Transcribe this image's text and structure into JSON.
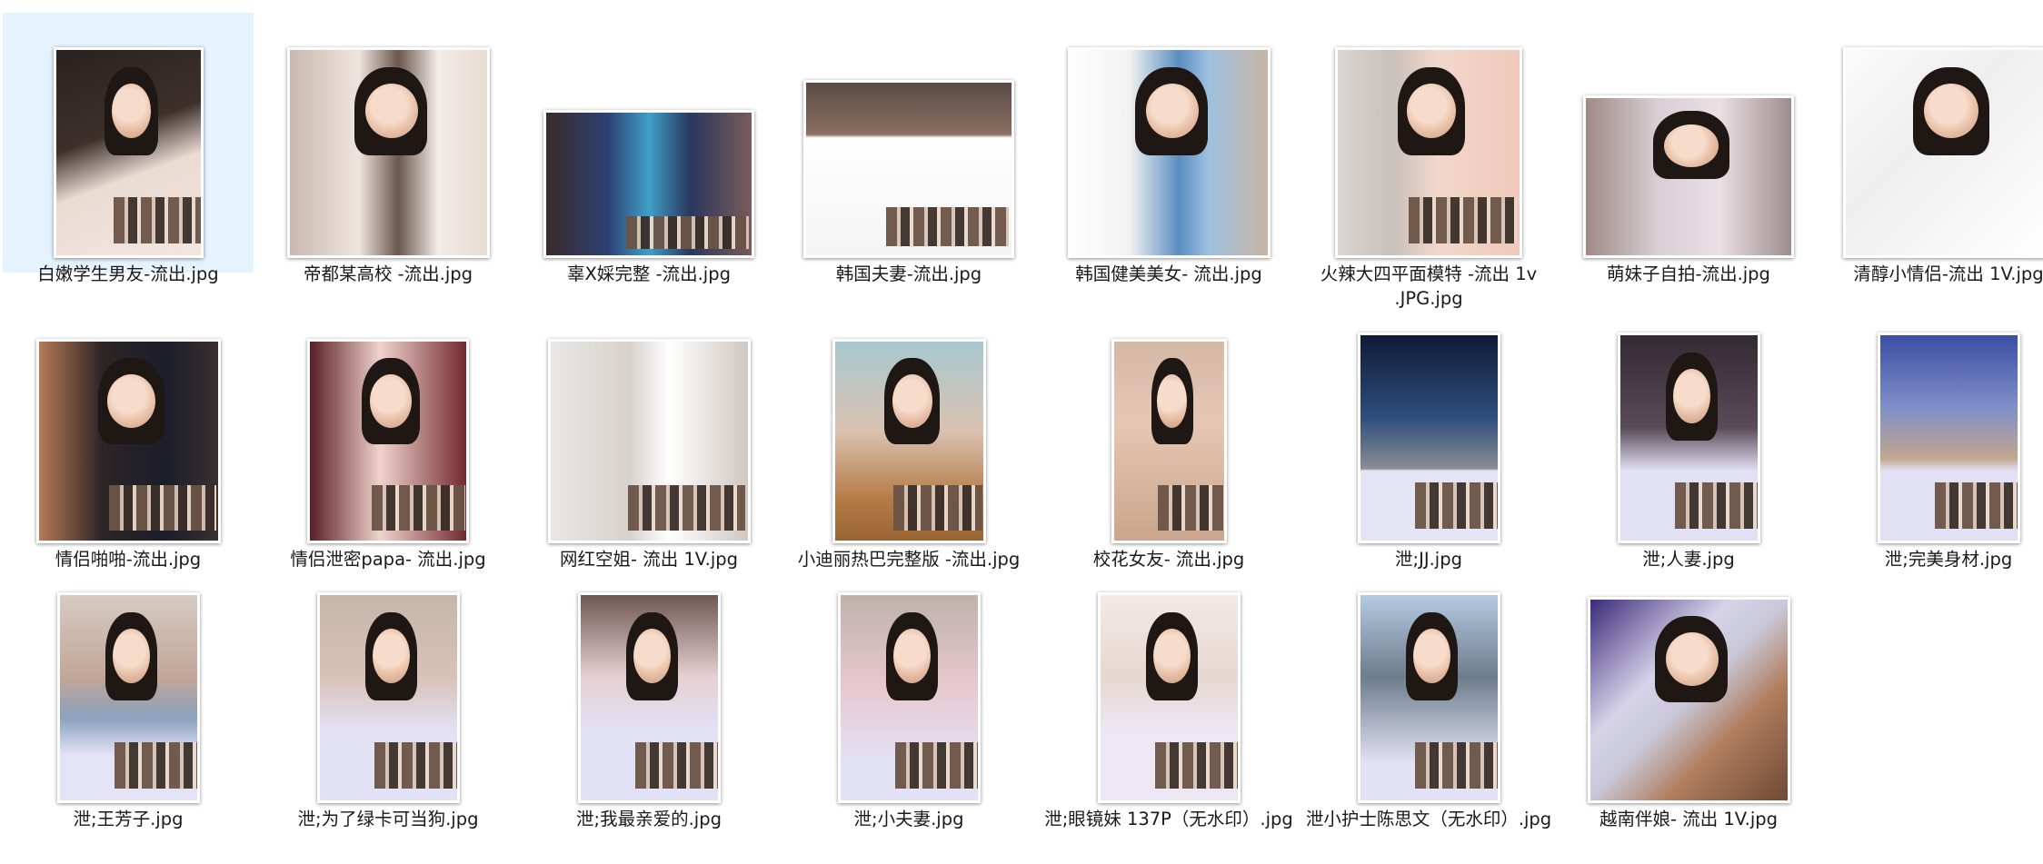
{
  "window": {
    "view": "large-icons"
  },
  "colors": {
    "selection_bg": "#e5f3ff",
    "text": "#1a1a1a"
  },
  "files": [
    {
      "name": "白嫩学生男友-流出.jpg",
      "selected": true,
      "thumb": {
        "w": 172,
        "h": 242,
        "bg": "linear-gradient(160deg,#2a2220 0%,#3d302b 40%,#eadbd3 60%,#f2e6df 100%)",
        "face": true,
        "strip": true
      }
    },
    {
      "name": "帝都某高校 -流出.jpg",
      "selected": false,
      "thumb": {
        "w": 232,
        "h": 242,
        "bg": "linear-gradient(90deg,#c9b8ae 0%,#efe4de 35%,#6a574d 55%,#f4ece8 75%,#e8dbd3 100%)",
        "face": true,
        "strip": false
      }
    },
    {
      "name": "辜X婇完整 -流出.jpg",
      "selected": false,
      "thumb": {
        "w": 242,
        "h": 170,
        "bg": "linear-gradient(90deg,#3b2a2a 0%,#2d3f73 30%,#3fa0c8 50%,#29375e 70%,#7a5b5a 100%)",
        "face": false,
        "strip": true
      }
    },
    {
      "name": "韩国夫妻-流出.jpg",
      "selected": false,
      "thumb": {
        "w": 242,
        "h": 204,
        "bg": "linear-gradient(180deg,#5a4a44 0%,#8b6f62 30%,#ffffff 32%,#f4f4f4 100%)",
        "face": false,
        "strip": true
      }
    },
    {
      "name": "韩国健美美女- 流出.jpg",
      "selected": false,
      "thumb": {
        "w": 232,
        "h": 242,
        "bg": "linear-gradient(90deg,#ffffff 0%,#f1f1f1 30%,#5a8dc0 55%,#9fc1e0 70%,#c8b4a4 100%)",
        "face": true,
        "strip": false
      }
    },
    {
      "name": "火辣大四平面模特 -流出 1v\n.JPG.jpg",
      "selected": false,
      "thumb": {
        "w": 215,
        "h": 242,
        "bg": "linear-gradient(90deg,#d9d5d2 0%,#c8c1bb 30%,#f2d7cb 55%,#f0c9bb 100%)",
        "face": true,
        "strip": true
      }
    },
    {
      "name": "萌妹子自拍-流出.jpg",
      "selected": false,
      "thumb": {
        "w": 242,
        "h": 186,
        "bg": "linear-gradient(90deg,#a08a86 0%,#d8cfd4 35%,#eadfe4 65%,#9e8c8d 100%)",
        "face": true,
        "strip": false
      }
    },
    {
      "name": "清醇小情侣-流出 1V.jpg",
      "selected": false,
      "thumb": {
        "w": 242,
        "h": 242,
        "bg": "linear-gradient(135deg,#fbfbfb 0%,#efeeee 40%,#ffffff 100%)",
        "face": true,
        "strip": false
      }
    },
    {
      "name": "情侣啪啪-流出.jpg",
      "selected": false,
      "thumb": {
        "w": 211,
        "h": 234,
        "bg": "linear-gradient(90deg,#b67a56 0%,#2d2525 35%,#1b1d2a 70%,#3a3030 100%)",
        "face": true,
        "strip": true
      }
    },
    {
      "name": "情侣泄密papa- 流出.jpg",
      "selected": false,
      "thumb": {
        "w": 185,
        "h": 234,
        "bg": "linear-gradient(90deg,#5a1f24 0%,#f0d3cd 45%,#722a30 100%)",
        "face": true,
        "strip": true
      }
    },
    {
      "name": "网红空姐- 流出 1V.jpg",
      "selected": false,
      "thumb": {
        "w": 232,
        "h": 234,
        "bg": "linear-gradient(90deg,#e9e6e4 0%,#d7d2cd 40%,#ffffff 60%,#cfc7c1 100%)",
        "face": false,
        "strip": true
      }
    },
    {
      "name": "小迪丽热巴完整版 -流出.jpg",
      "selected": false,
      "thumb": {
        "w": 176,
        "h": 234,
        "bg": "linear-gradient(180deg,#a7c8d0 0%,#dac2b1 45%,#b37a45 80%,#9a6535 100%)",
        "face": true,
        "strip": true
      }
    },
    {
      "name": "校花女友- 流出.jpg",
      "selected": false,
      "thumb": {
        "w": 132,
        "h": 234,
        "bg": "linear-gradient(180deg,#d3b8a4 0%,#e5c7b4 40%,#caa58c 100%)",
        "face": true,
        "strip": true
      }
    },
    {
      "name": "泄;JJ.jpg",
      "selected": false,
      "thumb": {
        "w": 164,
        "h": 242,
        "bg": "linear-gradient(180deg,#0f1b36 0%,#2f4d7c 40%,#8b8d93 65%,#e4e4f4 66%,#e4e4f4 100%)",
        "face": false,
        "strip": true
      }
    },
    {
      "name": "泄;人妻.jpg",
      "selected": false,
      "thumb": {
        "w": 164,
        "h": 242,
        "bg": "linear-gradient(180deg,#332a33 0%,#5a4b58 45%,#e2e0f5 66%,#e2e0f5 100%)",
        "face": true,
        "strip": true
      }
    },
    {
      "name": "泄;完美身材.jpg",
      "selected": false,
      "thumb": {
        "w": 164,
        "h": 242,
        "bg": "linear-gradient(180deg,#3b4ea3 0%,#7f8fc9 35%,#c1a78d 60%,#e2e0f5 66%,#e2e0f5 100%)",
        "face": false,
        "strip": true
      }
    },
    {
      "name": "泄;王芳子.jpg",
      "selected": false,
      "thumb": {
        "w": 164,
        "h": 242,
        "bg": "linear-gradient(180deg,#d7cbc3 0%,#c2a697 40%,#8aa1bd 60%,#e4e3f6 78%,#e4e3f6 100%)",
        "face": true,
        "strip": true
      }
    },
    {
      "name": "泄;为了绿卡可当狗.jpg",
      "selected": false,
      "thumb": {
        "w": 164,
        "h": 242,
        "bg": "linear-gradient(180deg,#c6b6a9 0%,#d9c1b7 40%,#e3e1f6 66%,#e3e1f6 100%)",
        "face": true,
        "strip": true
      }
    },
    {
      "name": "泄;我最亲爱的.jpg",
      "selected": false,
      "thumb": {
        "w": 164,
        "h": 242,
        "bg": "linear-gradient(180deg,#6f5752 0%,#e6d0d3 40%,#e3e1f6 66%,#e3e1f6 100%)",
        "face": true,
        "strip": true
      }
    },
    {
      "name": "泄;小夫妻.jpg",
      "selected": false,
      "thumb": {
        "w": 164,
        "h": 242,
        "bg": "linear-gradient(180deg,#bfb2ac 0%,#e8c8cf 45%,#e3e1f6 80%,#e3e1f6 100%)",
        "face": true,
        "strip": true
      }
    },
    {
      "name": "泄;眼镜妹 137P（无水印）.jpg",
      "selected": false,
      "thumb": {
        "w": 164,
        "h": 242,
        "bg": "linear-gradient(180deg,#f3e9e6 0%,#e6d7d0 40%,#ece7f3 66%,#ece7f3 100%)",
        "face": true,
        "strip": true
      }
    },
    {
      "name": "泄小护士陈思文（无水印）.jpg",
      "selected": false,
      "thumb": {
        "w": 164,
        "h": 242,
        "bg": "linear-gradient(180deg,#b5c9e2 0%,#6d7d8c 40%,#e3e1f6 82%,#e3e1f6 100%)",
        "face": true,
        "strip": true
      }
    },
    {
      "name": "越南伴娘- 流出 1V.jpg",
      "selected": false,
      "thumb": {
        "w": 232,
        "h": 236,
        "bg": "linear-gradient(135deg,#3a2a7a 0%,#d6d3e8 35%,#c9c7d9 50%,#b07c5c 70%,#6e4a37 100%)",
        "face": true,
        "strip": false
      }
    }
  ]
}
